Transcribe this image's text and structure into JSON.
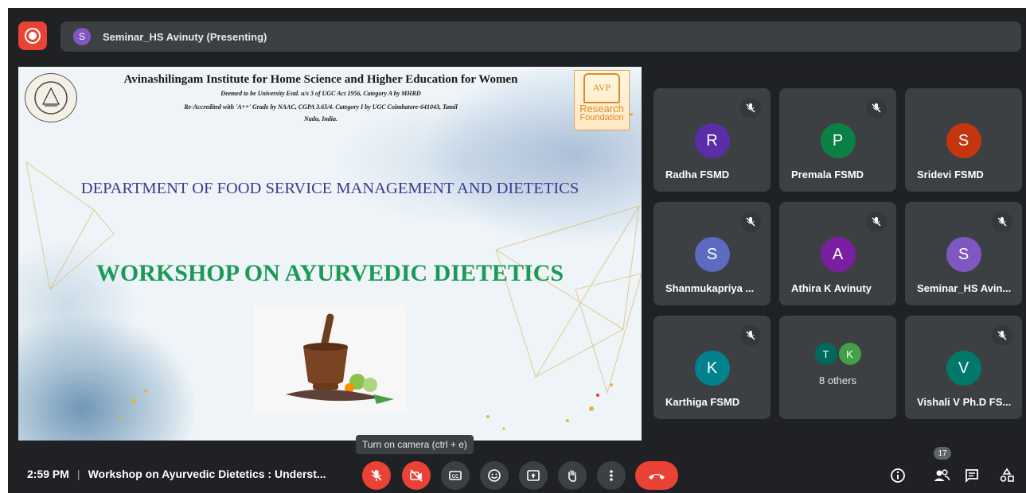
{
  "presenter": {
    "avatar_letter": "S",
    "label": "Seminar_HS Avinuty (Presenting)"
  },
  "slide": {
    "institution": "Avinashilingam Institute for Home Science and Higher Education for Women",
    "line2": "Deemed to be University Estd. u/s 3 of UGC Act 1956, Category A by MHRD",
    "line3": "Re-Accredited with 'A++' Grade by NAAC, CGPA 3.65/4. Category I by UGC Coimbatore-641043, Tamil",
    "line4": "Nadu, India.",
    "logo_text": "AVP",
    "logo_line1": "Research",
    "logo_line2": "Foundation",
    "department": "DEPARTMENT OF FOOD SERVICE MANAGEMENT AND DIETETICS",
    "workshop": "WORKSHOP ON AYURVEDIC DIETETICS"
  },
  "participants": [
    {
      "letter": "R",
      "name": "Radha FSMD",
      "color": "#5b2da8"
    },
    {
      "letter": "P",
      "name": "Premala FSMD",
      "color": "#0b8043"
    },
    {
      "letter": "S",
      "name": "Sridevi FSMD",
      "color": "#c5360f"
    },
    {
      "letter": "S",
      "name": "Shanmukapriya ...",
      "color": "#5c6bc0"
    },
    {
      "letter": "A",
      "name": "Athira K Avinuty",
      "color": "#7b1fa2"
    },
    {
      "letter": "S",
      "name": "Seminar_HS Avin...",
      "color": "#7e57c2"
    },
    {
      "letter": "K",
      "name": "Karthiga FSMD",
      "color": "#00838f"
    },
    {
      "letter": "V",
      "name": "Vishali V Ph.D FS...",
      "color": "#00796b"
    }
  ],
  "others": {
    "letter1": "T",
    "letter2": "K",
    "color1": "#00695c",
    "color2": "#43a047",
    "label": "8 others"
  },
  "tooltip": "Turn on camera (ctrl + e)",
  "meeting": {
    "time": "2:59 PM",
    "separator": "|",
    "title": "Workshop on Ayurvedic Dietetics : Underst..."
  },
  "people_count": "17",
  "colors": {
    "background": "#202124",
    "tile": "#3c4043",
    "danger": "#ea4335"
  },
  "controls": [
    "mic-off-icon",
    "camera-off-icon",
    "captions-icon",
    "emoji-icon",
    "present-icon",
    "raise-hand-icon",
    "more-options-icon",
    "end-call-icon"
  ]
}
